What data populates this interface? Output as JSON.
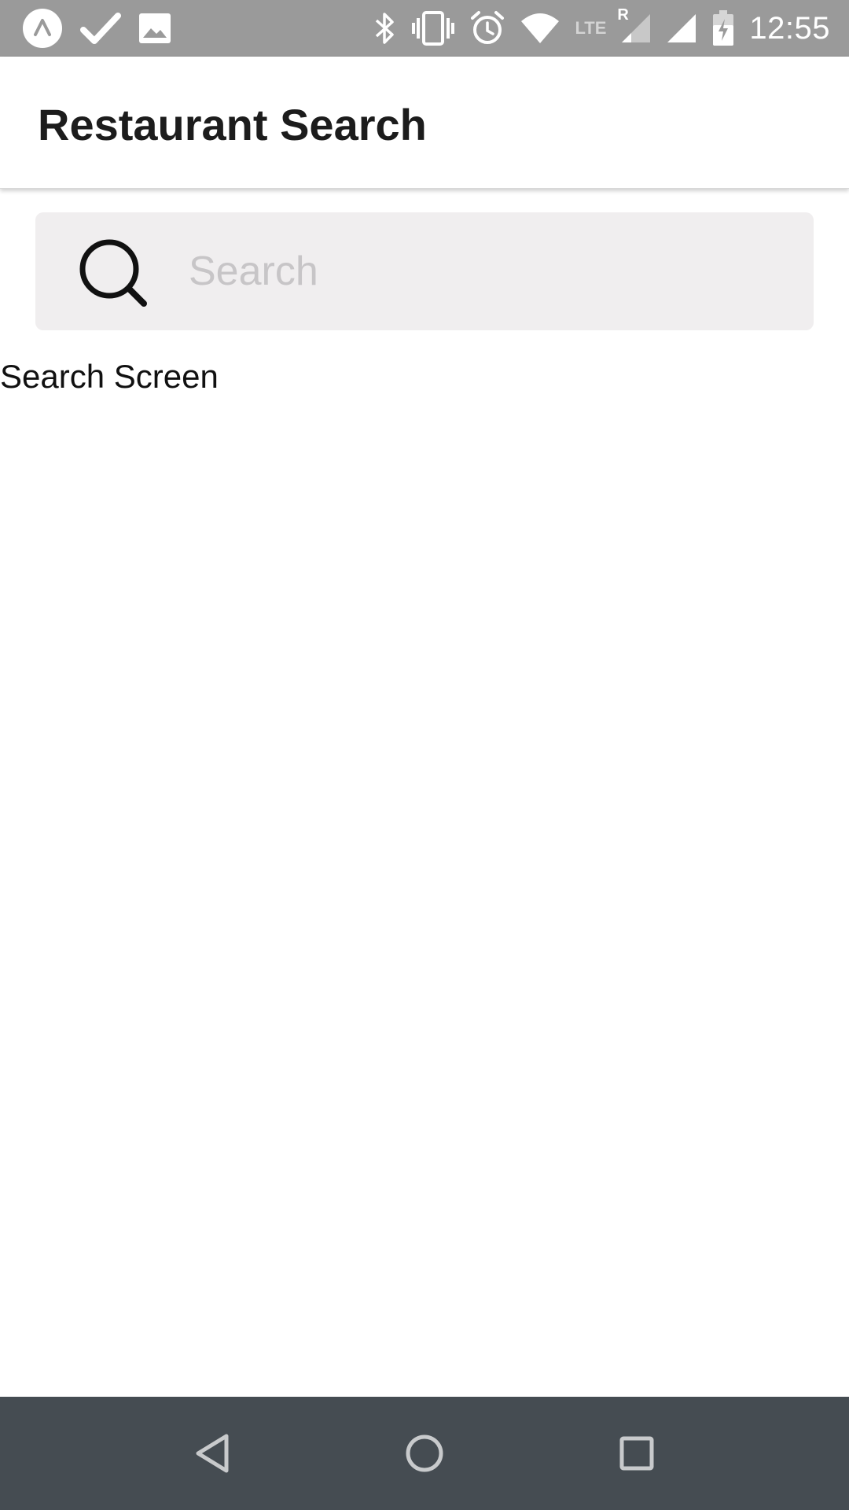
{
  "status_bar": {
    "time": "12:55",
    "left_icons": [
      "expo-icon",
      "check-icon",
      "image-icon"
    ],
    "right_icons": [
      "bluetooth-icon",
      "vibrate-icon",
      "alarm-icon",
      "wifi-icon",
      "lte-icon",
      "signal-roaming-icon",
      "signal-icon",
      "battery-charging-icon"
    ],
    "lte_label": "LTE",
    "roaming_label": "R"
  },
  "header": {
    "title": "Restaurant Search"
  },
  "search": {
    "placeholder": "Search",
    "value": ""
  },
  "main": {
    "screen_label": "Search Screen"
  },
  "nav_bar": {
    "buttons": [
      "back-icon",
      "home-icon",
      "recents-icon"
    ]
  },
  "colors": {
    "status_bar_bg": "#9a9a9a",
    "search_bg": "#f0eeef",
    "nav_bar_bg": "#454c52",
    "title_text": "#1c1c1c"
  }
}
